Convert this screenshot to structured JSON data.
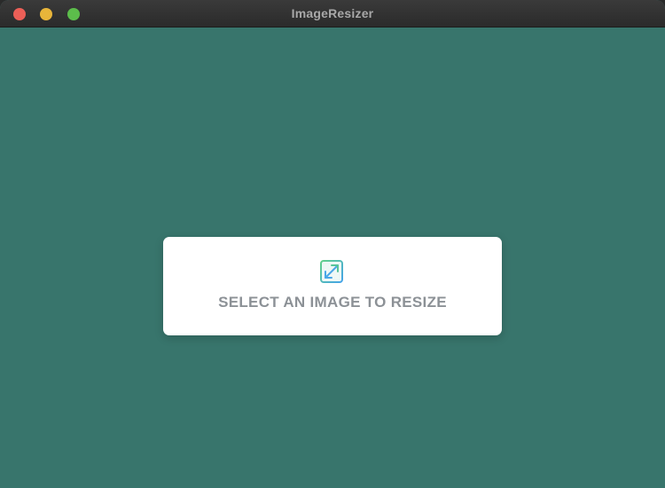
{
  "window": {
    "title": "ImageResizer"
  },
  "dropzone": {
    "label": "SELECT AN IMAGE TO RESIZE",
    "icon": "resize-expand-icon"
  },
  "colors": {
    "background": "#38756c",
    "card": "#ffffff",
    "label": "#8c9196",
    "icon_green": "#56c49a",
    "icon_blue": "#4aa7e8"
  }
}
